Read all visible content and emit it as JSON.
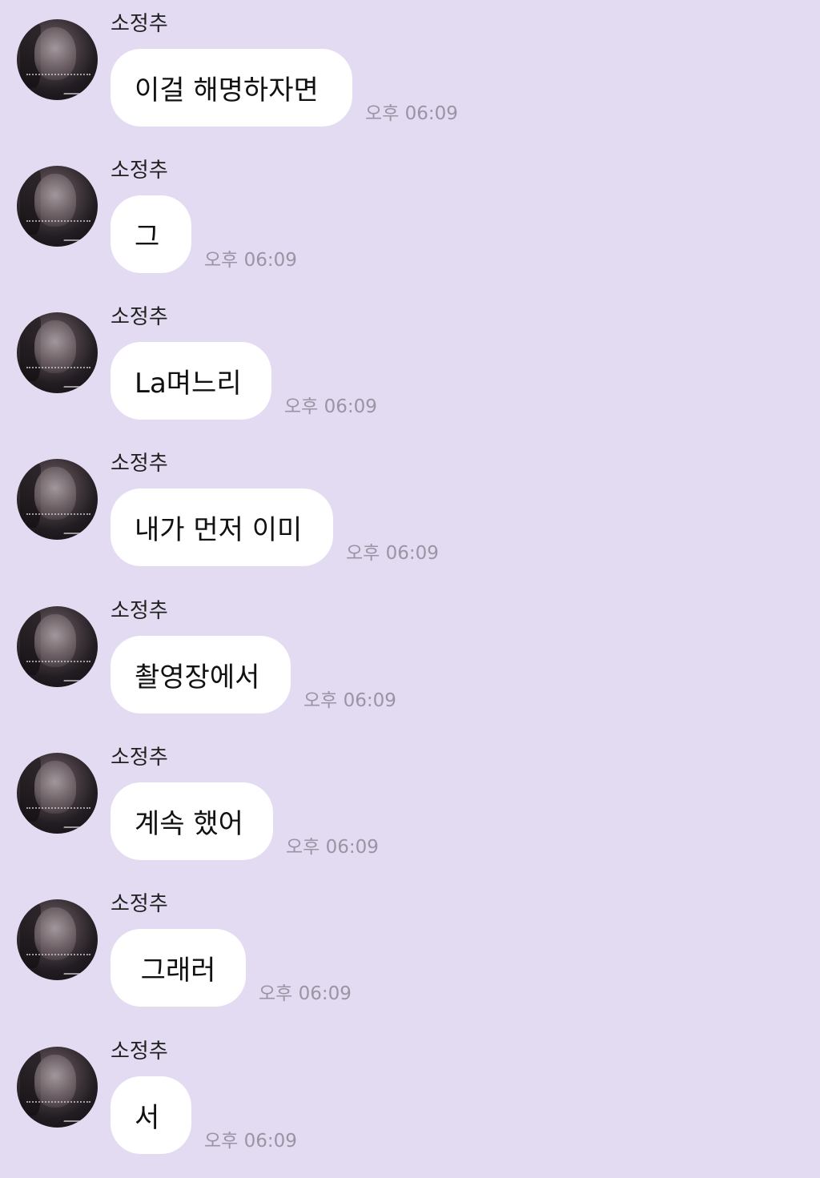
{
  "background_color": "#e3dbf2",
  "bubble_color": "#ffffff",
  "timestamp_color": "#9a94a3",
  "messages": [
    {
      "sender": "소정추",
      "text": "이걸 해명하자면",
      "time": "오후 06:09"
    },
    {
      "sender": "소정추",
      "text": "그",
      "time": "오후 06:09"
    },
    {
      "sender": "소정추",
      "text": "La며느리",
      "time": "오후 06:09"
    },
    {
      "sender": "소정추",
      "text": "내가 먼저 이미",
      "time": "오후 06:09"
    },
    {
      "sender": "소정추",
      "text": "촬영장에서",
      "time": "오후 06:09"
    },
    {
      "sender": "소정추",
      "text": "계속 했어",
      "time": "오후 06:09"
    },
    {
      "sender": "소정추",
      "text": "그래러",
      "time": "오후 06:09"
    },
    {
      "sender": "소정추",
      "text": "서",
      "time": "오후 06:09"
    }
  ]
}
